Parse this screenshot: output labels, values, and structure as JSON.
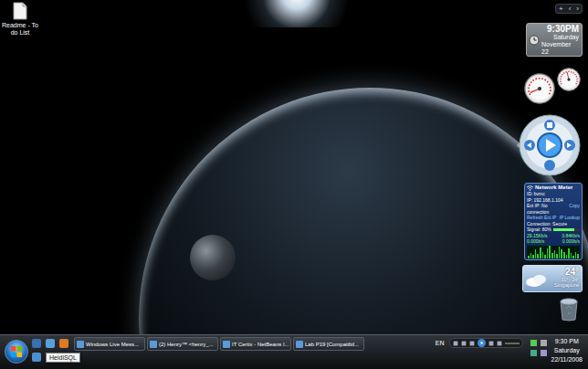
{
  "desktop_icons": [
    {
      "label": "Readme - To do List"
    }
  ],
  "sidebar": {
    "controls": [
      "+",
      "‹",
      "›"
    ]
  },
  "clock_gadget": {
    "time": "9:30PM",
    "day": "Saturday",
    "date": "November 22"
  },
  "cpu_meter": {
    "cpu_level": 0.08,
    "memory_level": 0.45
  },
  "network_meter": {
    "title": "Network Meter",
    "id": "ID: bvmc",
    "ip": "IP: 192.168.1.104",
    "ext_ip": "Ext IP: No connection",
    "copy": "Copy",
    "refresh": "Refresh Ext.IP",
    "lookup": "IP Lookup",
    "connection": "Connection: Secure",
    "signal": "Signal: 80%",
    "signal_level": 0.8,
    "rates": {
      "current_in": "29.15Kb/s",
      "current_out": "3.84Kb/s",
      "total_in": "0.000b/s",
      "total_out": "0.000b/s"
    },
    "graph": [
      2,
      5,
      3,
      8,
      4,
      10,
      6,
      3,
      9,
      12,
      5,
      7,
      4,
      11,
      8,
      6,
      3,
      9,
      5,
      2,
      6,
      4
    ]
  },
  "weather": {
    "temperature": "24°",
    "range": "31° - 24°",
    "city": "Singapore"
  },
  "taskbar": {
    "quick_launch_tooltip": "HeidiSQL",
    "tasks": [
      {
        "label": "Windows Live Mess...",
        "selected": false
      },
      {
        "label": "(2) Henry™ <henry_...",
        "selected": false
      },
      {
        "label": "IT Certix - NetBeans I...",
        "selected": false
      },
      {
        "label": "Lab P19 [Compatibil...",
        "selected": false
      }
    ],
    "language": "EN",
    "clock": {
      "time": "9:30 PM",
      "day": "Saturday",
      "date": "22/11/2008"
    }
  }
}
